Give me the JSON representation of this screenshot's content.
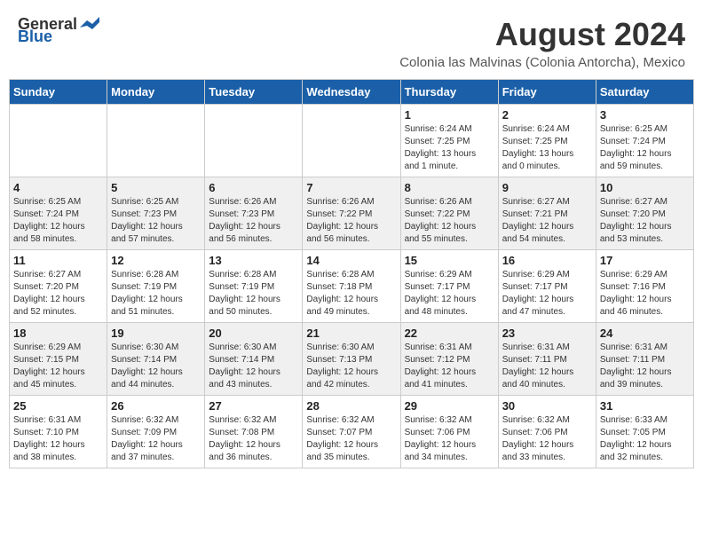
{
  "logo": {
    "general": "General",
    "blue": "Blue"
  },
  "title": "August 2024",
  "subtitle": "Colonia las Malvinas (Colonia Antorcha), Mexico",
  "days_of_week": [
    "Sunday",
    "Monday",
    "Tuesday",
    "Wednesday",
    "Thursday",
    "Friday",
    "Saturday"
  ],
  "weeks": [
    [
      {
        "day": "",
        "info": ""
      },
      {
        "day": "",
        "info": ""
      },
      {
        "day": "",
        "info": ""
      },
      {
        "day": "",
        "info": ""
      },
      {
        "day": "1",
        "info": "Sunrise: 6:24 AM\nSunset: 7:25 PM\nDaylight: 13 hours\nand 1 minute."
      },
      {
        "day": "2",
        "info": "Sunrise: 6:24 AM\nSunset: 7:25 PM\nDaylight: 13 hours\nand 0 minutes."
      },
      {
        "day": "3",
        "info": "Sunrise: 6:25 AM\nSunset: 7:24 PM\nDaylight: 12 hours\nand 59 minutes."
      }
    ],
    [
      {
        "day": "4",
        "info": "Sunrise: 6:25 AM\nSunset: 7:24 PM\nDaylight: 12 hours\nand 58 minutes."
      },
      {
        "day": "5",
        "info": "Sunrise: 6:25 AM\nSunset: 7:23 PM\nDaylight: 12 hours\nand 57 minutes."
      },
      {
        "day": "6",
        "info": "Sunrise: 6:26 AM\nSunset: 7:23 PM\nDaylight: 12 hours\nand 56 minutes."
      },
      {
        "day": "7",
        "info": "Sunrise: 6:26 AM\nSunset: 7:22 PM\nDaylight: 12 hours\nand 56 minutes."
      },
      {
        "day": "8",
        "info": "Sunrise: 6:26 AM\nSunset: 7:22 PM\nDaylight: 12 hours\nand 55 minutes."
      },
      {
        "day": "9",
        "info": "Sunrise: 6:27 AM\nSunset: 7:21 PM\nDaylight: 12 hours\nand 54 minutes."
      },
      {
        "day": "10",
        "info": "Sunrise: 6:27 AM\nSunset: 7:20 PM\nDaylight: 12 hours\nand 53 minutes."
      }
    ],
    [
      {
        "day": "11",
        "info": "Sunrise: 6:27 AM\nSunset: 7:20 PM\nDaylight: 12 hours\nand 52 minutes."
      },
      {
        "day": "12",
        "info": "Sunrise: 6:28 AM\nSunset: 7:19 PM\nDaylight: 12 hours\nand 51 minutes."
      },
      {
        "day": "13",
        "info": "Sunrise: 6:28 AM\nSunset: 7:19 PM\nDaylight: 12 hours\nand 50 minutes."
      },
      {
        "day": "14",
        "info": "Sunrise: 6:28 AM\nSunset: 7:18 PM\nDaylight: 12 hours\nand 49 minutes."
      },
      {
        "day": "15",
        "info": "Sunrise: 6:29 AM\nSunset: 7:17 PM\nDaylight: 12 hours\nand 48 minutes."
      },
      {
        "day": "16",
        "info": "Sunrise: 6:29 AM\nSunset: 7:17 PM\nDaylight: 12 hours\nand 47 minutes."
      },
      {
        "day": "17",
        "info": "Sunrise: 6:29 AM\nSunset: 7:16 PM\nDaylight: 12 hours\nand 46 minutes."
      }
    ],
    [
      {
        "day": "18",
        "info": "Sunrise: 6:29 AM\nSunset: 7:15 PM\nDaylight: 12 hours\nand 45 minutes."
      },
      {
        "day": "19",
        "info": "Sunrise: 6:30 AM\nSunset: 7:14 PM\nDaylight: 12 hours\nand 44 minutes."
      },
      {
        "day": "20",
        "info": "Sunrise: 6:30 AM\nSunset: 7:14 PM\nDaylight: 12 hours\nand 43 minutes."
      },
      {
        "day": "21",
        "info": "Sunrise: 6:30 AM\nSunset: 7:13 PM\nDaylight: 12 hours\nand 42 minutes."
      },
      {
        "day": "22",
        "info": "Sunrise: 6:31 AM\nSunset: 7:12 PM\nDaylight: 12 hours\nand 41 minutes."
      },
      {
        "day": "23",
        "info": "Sunrise: 6:31 AM\nSunset: 7:11 PM\nDaylight: 12 hours\nand 40 minutes."
      },
      {
        "day": "24",
        "info": "Sunrise: 6:31 AM\nSunset: 7:11 PM\nDaylight: 12 hours\nand 39 minutes."
      }
    ],
    [
      {
        "day": "25",
        "info": "Sunrise: 6:31 AM\nSunset: 7:10 PM\nDaylight: 12 hours\nand 38 minutes."
      },
      {
        "day": "26",
        "info": "Sunrise: 6:32 AM\nSunset: 7:09 PM\nDaylight: 12 hours\nand 37 minutes."
      },
      {
        "day": "27",
        "info": "Sunrise: 6:32 AM\nSunset: 7:08 PM\nDaylight: 12 hours\nand 36 minutes."
      },
      {
        "day": "28",
        "info": "Sunrise: 6:32 AM\nSunset: 7:07 PM\nDaylight: 12 hours\nand 35 minutes."
      },
      {
        "day": "29",
        "info": "Sunrise: 6:32 AM\nSunset: 7:06 PM\nDaylight: 12 hours\nand 34 minutes."
      },
      {
        "day": "30",
        "info": "Sunrise: 6:32 AM\nSunset: 7:06 PM\nDaylight: 12 hours\nand 33 minutes."
      },
      {
        "day": "31",
        "info": "Sunrise: 6:33 AM\nSunset: 7:05 PM\nDaylight: 12 hours\nand 32 minutes."
      }
    ]
  ],
  "accent_color": "#1a5fa8"
}
